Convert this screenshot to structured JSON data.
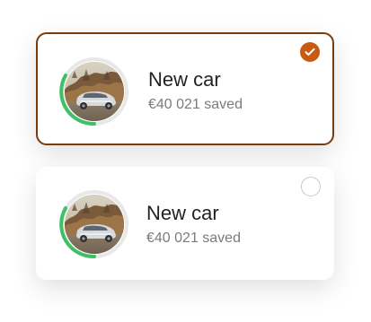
{
  "cards": [
    {
      "title": "New car",
      "saved_text": "€40 021 saved",
      "selected": true
    },
    {
      "title": "New car",
      "saved_text": "€40 021 saved",
      "selected": false
    }
  ],
  "colors": {
    "selected_border": "#7b3b0a",
    "check_fill": "#c85a12",
    "progress_ring": "#3fbf66",
    "ring_track": "#e8e8e8"
  },
  "icons": {
    "selected_indicator": "check-icon",
    "unselected_indicator": "radio-icon"
  }
}
